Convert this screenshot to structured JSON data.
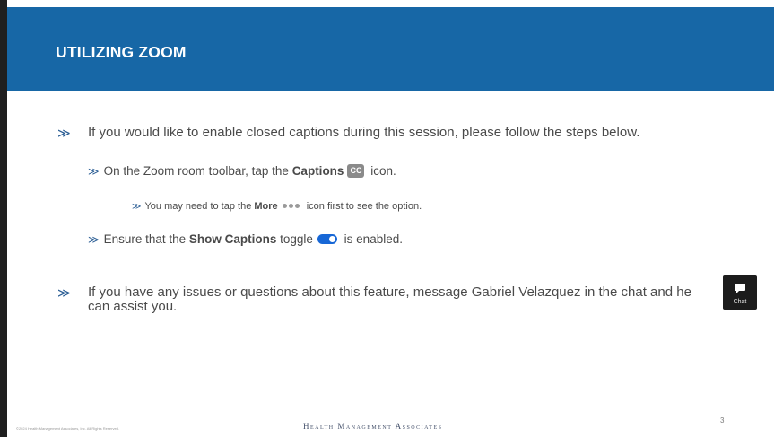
{
  "slide": {
    "title": "UTILIZING ZOOM",
    "bullets": {
      "b1": "If you would like to enable closed captions during this session, please follow the steps below.",
      "b2_pre": "On the Zoom room toolbar, tap the ",
      "b2_bold": "Captions",
      "b2_post": " icon.",
      "b3_pre": "You may need to tap the ",
      "b3_bold": "More",
      "b3_post": " icon first to see the option.",
      "b4_pre": "Ensure that the ",
      "b4_bold": "Show Captions",
      "b4_mid": " toggle",
      "b4_post": " is enabled.",
      "b5": "If you have any issues or questions about this feature, message Gabriel Velazquez in the chat and he can assist you."
    },
    "bullet_glyph": "≫",
    "cc_icon_label": "CC",
    "footer": {
      "copyright": "©2024 Health Management Associates, Inc. All Rights Reserved.",
      "brand": "Health Management Associates",
      "page_number": "3"
    }
  },
  "chat_button": {
    "label": "Chat"
  },
  "colors": {
    "header": "#1767a6",
    "chevron": "#2a5d94",
    "toggle": "#1767d6"
  }
}
